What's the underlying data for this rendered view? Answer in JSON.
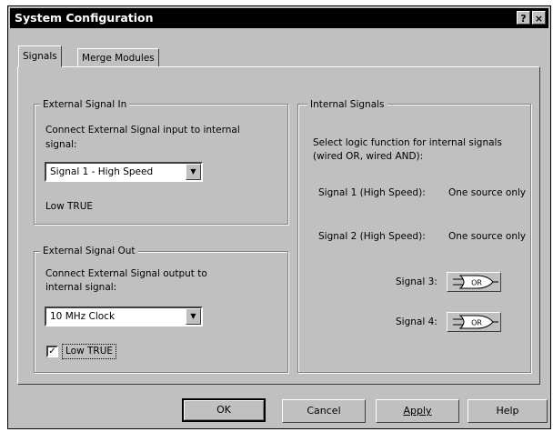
{
  "window": {
    "title": "System Configuration",
    "help_glyph": "?",
    "close_glyph": "×"
  },
  "tabs": [
    {
      "label": "Signals"
    },
    {
      "label": "Merge Modules"
    }
  ],
  "external_in": {
    "title": "External Signal In",
    "desc_line1": "Connect External Signal input to internal",
    "desc_line2": "signal:",
    "select_value": "Signal 1 - High Speed",
    "polarity": "Low TRUE"
  },
  "external_out": {
    "title": "External Signal Out",
    "desc_line1": "Connect External Signal output to",
    "desc_line2": "internal signal:",
    "select_value": "10 MHz Clock",
    "checkbox_label": "Low TRUE",
    "checkbox_checked": true
  },
  "internal": {
    "title": "Internal Signals",
    "desc_line1": "Select logic function for internal signals",
    "desc_line2": "(wired OR, wired AND):",
    "signal1_label": "Signal 1 (High Speed):",
    "signal1_value": "One source only",
    "signal2_label": "Signal 2 (High Speed):",
    "signal2_value": "One source only",
    "signal3_label": "Signal 3:",
    "signal4_label": "Signal 4:",
    "gate_text": "OR"
  },
  "buttons": {
    "ok": "OK",
    "cancel": "Cancel",
    "apply": "Apply",
    "help": "Help"
  }
}
